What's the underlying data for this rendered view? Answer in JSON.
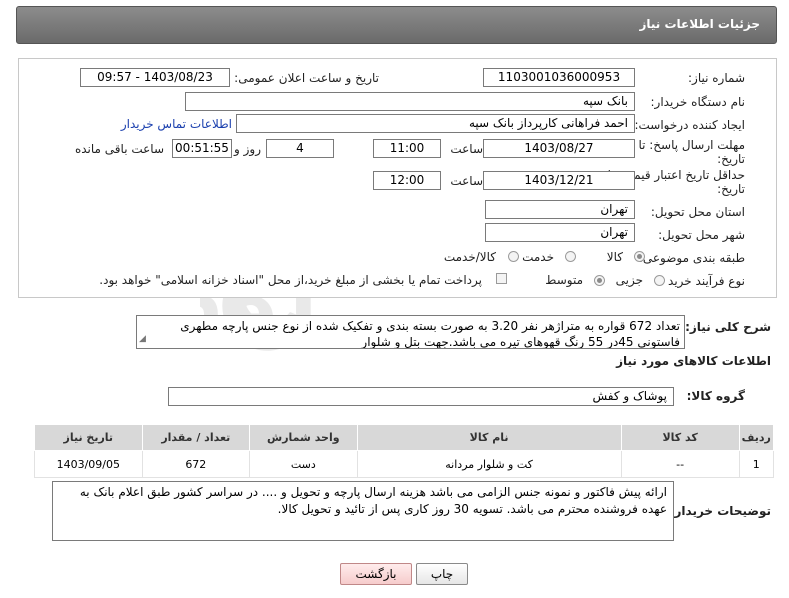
{
  "header": {
    "title": "جزئیات اطلاعات نیاز"
  },
  "form": {
    "need_number_label": "شماره نیاز:",
    "need_number": "1103001036000953",
    "announce_label": "تاریخ و ساعت اعلان عمومی:",
    "announce_value": "1403/08/23 - 09:57",
    "buyer_org_label": "نام دستگاه خریدار:",
    "buyer_org": "بانک سپه",
    "creator_label": "ایجاد کننده درخواست:",
    "creator": "احمد فراهانی کارپرداز بانک سپه",
    "contact_link": "اطلاعات تماس خریدار",
    "deadline_label": "مهلت ارسال پاسخ: تا",
    "deadline_label2": "تاریخ:",
    "deadline_date": "1403/08/27",
    "time_label": "ساعت",
    "deadline_time": "11:00",
    "days": "4",
    "days_label": "روز و",
    "remaining_time": "00:51:55",
    "remaining_label": "ساعت باقی مانده",
    "validity_label": "حداقل تاریخ اعتبار قیمت: تا",
    "validity_label2": "تاریخ:",
    "validity_date": "1403/12/21",
    "validity_time": "12:00",
    "province_label": "استان محل تحویل:",
    "province": "تهران",
    "city_label": "شهر محل تحویل:",
    "city": "تهران",
    "category_label": "طبقه بندی موضوعی:",
    "category_options": [
      "کالا",
      "خدمت",
      "کالا/خدمت"
    ],
    "process_label": "نوع فرآیند خرید :",
    "process_options": [
      "جزیی",
      "متوسط"
    ],
    "payment_note": "پرداخت تمام یا بخشی از مبلغ خرید،از محل \"اسناد خزانه اسلامی\" خواهد بود."
  },
  "description": {
    "label": "شرح کلی نیاز:",
    "text": "تعداد 672 قواره به متراژهر نفر 3.20 به صورت بسته بندی و تفکیک شده از نوع جنس پارچه مطهری فاستونی 45در 55 رنگ قهوهای تیره  می باشد.جهت بتل و شلوار"
  },
  "goods": {
    "section_title": "اطلاعات کالاهای مورد نیاز",
    "group_label": "گروه کالا:",
    "group_value": "پوشاک و کفش",
    "columns": [
      "ردیف",
      "کد کالا",
      "نام کالا",
      "واحد شمارش",
      "تعداد / مقدار",
      "تاریخ نیاز"
    ],
    "rows": [
      [
        "1",
        "--",
        "کت و شلوار مردانه",
        "دست",
        "672",
        "1403/09/05"
      ]
    ]
  },
  "notes": {
    "label": "توضیحات خریدار:",
    "text": "ارائه پیش فاکتور و نمونه جنس الزامی می باشد هزینه ارسال پارچه و تحویل و .... در سراسر کشور طبق اعلام بانک به عهده فروشنده محترم می باشد. تسویه 30 روز کاری پس از تائید و تحویل کالا."
  },
  "buttons": {
    "print": "چاپ",
    "back": "بازگشت"
  },
  "colors": {
    "header": "#7a7a7a",
    "back_button": "#f6cccc",
    "link": "#1a3fae"
  }
}
